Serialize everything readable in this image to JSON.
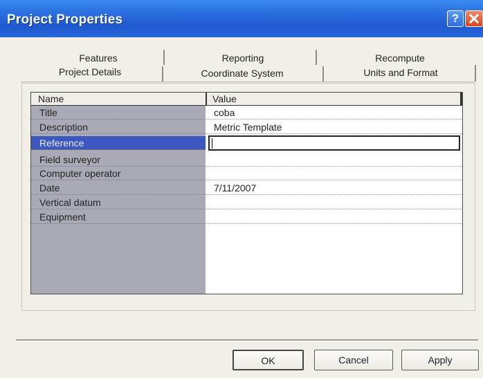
{
  "window": {
    "title": "Project Properties",
    "help_label": "?"
  },
  "tabs": {
    "row1": [
      "Features",
      "Reporting",
      "Recompute"
    ],
    "row2": [
      "Project Details",
      "Coordinate System",
      "Units and Format"
    ],
    "active": "Project Details"
  },
  "grid": {
    "header_name": "Name",
    "header_value": "Value",
    "rows": [
      {
        "name": "Title",
        "value": "coba"
      },
      {
        "name": "Description",
        "value": "Metric Template"
      },
      {
        "name": "Reference",
        "value": ""
      },
      {
        "name": "Field surveyor",
        "value": ""
      },
      {
        "name": "Computer operator",
        "value": ""
      },
      {
        "name": "Date",
        "value": "7/11/2007"
      },
      {
        "name": "Vertical datum",
        "value": ""
      },
      {
        "name": "Equipment",
        "value": ""
      }
    ],
    "selected_row": "Reference"
  },
  "buttons": {
    "ok": "OK",
    "cancel": "Cancel",
    "apply": "Apply"
  },
  "colors": {
    "titlebar": "#2b6fe0",
    "selection": "#3a58c0",
    "name_column": "#a9aab6"
  }
}
